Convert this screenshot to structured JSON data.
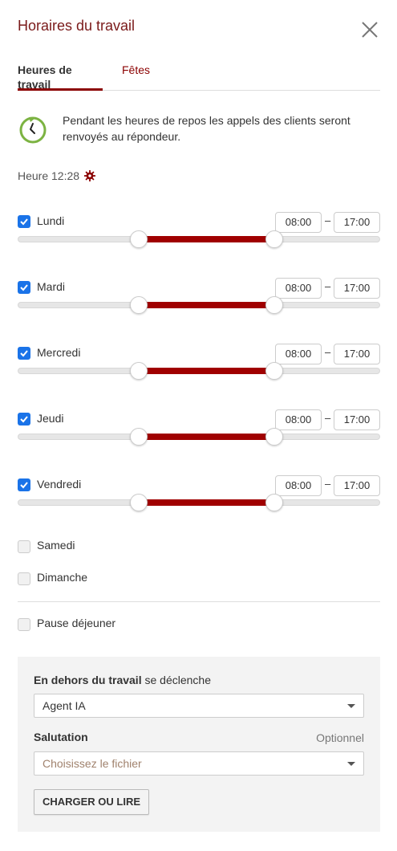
{
  "header": {
    "title": "Horaires du travail",
    "close_icon": "close-icon"
  },
  "tabs": [
    {
      "label": "Heures de travail",
      "active": true
    },
    {
      "label": "Fêtes",
      "active": false
    }
  ],
  "info": {
    "icon": "clock-refresh-icon",
    "text": "Pendant les heures de repos les appels des clients seront renvoyés au répondeur."
  },
  "time": {
    "label": "Heure 12:28",
    "icon": "gear-icon"
  },
  "days": [
    {
      "label": "Lundi",
      "checked": true,
      "from": "08:00",
      "to": "17:00"
    },
    {
      "label": "Mardi",
      "checked": true,
      "from": "08:00",
      "to": "17:00"
    },
    {
      "label": "Mercredi",
      "checked": true,
      "from": "08:00",
      "to": "17:00"
    },
    {
      "label": "Jeudi",
      "checked": true,
      "from": "08:00",
      "to": "17:00"
    },
    {
      "label": "Vendredi",
      "checked": true,
      "from": "08:00",
      "to": "17:00"
    },
    {
      "label": "Samedi",
      "checked": false
    },
    {
      "label": "Dimanche",
      "checked": false
    }
  ],
  "dash": "–",
  "lunch": {
    "label": "Pause déjeuner",
    "checked": false
  },
  "panel": {
    "trigger_bold": "En dehors du travail",
    "trigger_rest": " se déclenche",
    "trigger_value": "Agent IA",
    "salutation_label": "Salutation",
    "optional_label": "Optionnel",
    "file_placeholder": "Choisissez le fichier",
    "button_label": "CHARGER OU LIRE"
  },
  "colors": {
    "accent": "#8b0000",
    "range": "#a00000",
    "checkbox": "#1a73e8",
    "clock_icon": "#7cb342"
  }
}
